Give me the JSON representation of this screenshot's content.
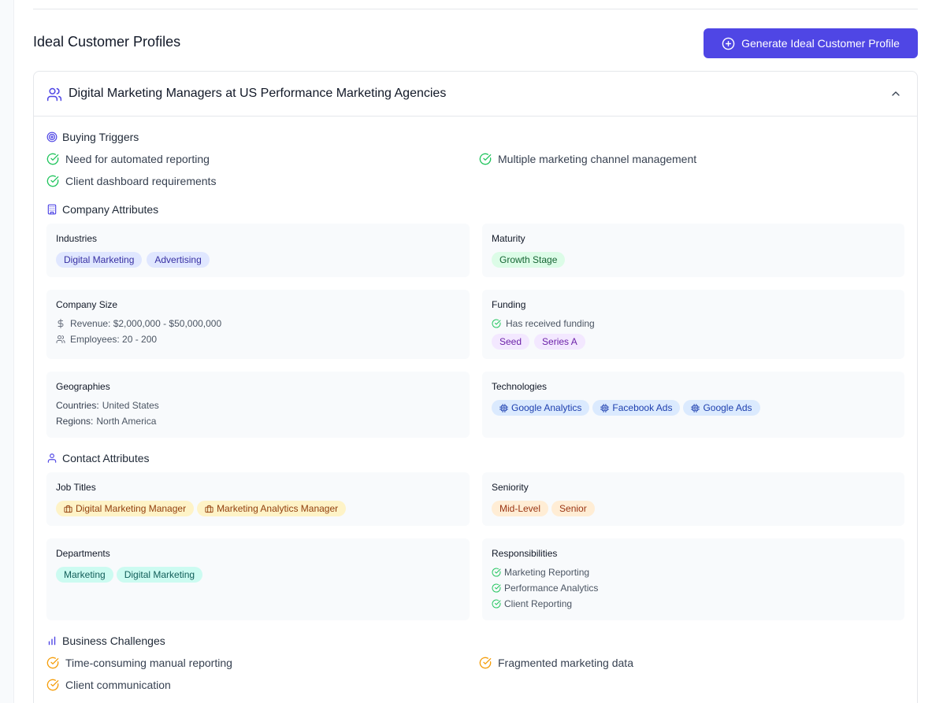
{
  "section": {
    "title": "Ideal Customer Profiles",
    "generate_label": "Generate Ideal Customer Profile"
  },
  "profile": {
    "title": "Digital Marketing Managers at US Performance Marketing Agencies",
    "buying_triggers": {
      "heading": "Buying Triggers",
      "items": [
        "Need for automated reporting",
        "Multiple marketing channel management",
        "Client dashboard requirements"
      ]
    },
    "company_attributes": {
      "heading": "Company Attributes",
      "industries": {
        "label": "Industries",
        "values": [
          "Digital Marketing",
          "Advertising"
        ]
      },
      "maturity": {
        "label": "Maturity",
        "values": [
          "Growth Stage"
        ]
      },
      "company_size": {
        "label": "Company Size",
        "revenue": "Revenue: $2,000,000 - $50,000,000",
        "employees": "Employees: 20 - 200"
      },
      "funding": {
        "label": "Funding",
        "status": "Has received funding",
        "values": [
          "Seed",
          "Series A"
        ]
      },
      "geographies": {
        "label": "Geographies",
        "countries_label": "Countries:",
        "countries": "United States",
        "regions_label": "Regions:",
        "regions": "North America"
      },
      "technologies": {
        "label": "Technologies",
        "values": [
          "Google Analytics",
          "Facebook Ads",
          "Google Ads"
        ]
      }
    },
    "contact_attributes": {
      "heading": "Contact Attributes",
      "job_titles": {
        "label": "Job Titles",
        "values": [
          "Digital Marketing Manager",
          "Marketing Analytics Manager"
        ]
      },
      "seniority": {
        "label": "Seniority",
        "values": [
          "Mid-Level",
          "Senior"
        ]
      },
      "departments": {
        "label": "Departments",
        "values": [
          "Marketing",
          "Digital Marketing"
        ]
      },
      "responsibilities": {
        "label": "Responsibilities",
        "values": [
          "Marketing Reporting",
          "Performance Analytics",
          "Client Reporting"
        ]
      }
    },
    "business_challenges": {
      "heading": "Business Challenges",
      "items": [
        "Time-consuming manual reporting",
        "Fragmented marketing data",
        "Client communication"
      ]
    }
  },
  "colors": {
    "accent": "#4f46e5",
    "success": "#22c55e",
    "warning": "#f59e0b"
  },
  "icons": {
    "generate": "plus-circle-icon",
    "profile": "users-icon",
    "collapse": "chevron-up-icon",
    "triggers": "target-icon",
    "company": "building-icon",
    "contact": "user-icon",
    "challenges": "bar-chart-icon",
    "check": "check-circle-icon",
    "revenue": "dollar-icon",
    "employees": "users-icon",
    "technology": "cpu-icon",
    "job": "briefcase-icon"
  }
}
